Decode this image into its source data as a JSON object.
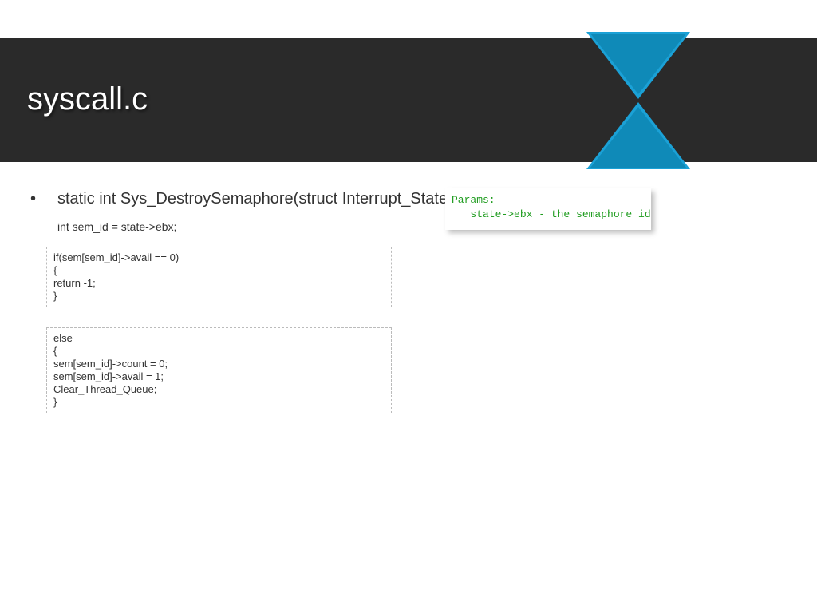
{
  "header": {
    "title": "syscall.c"
  },
  "content": {
    "bullet": "•",
    "func_sig": "static int Sys_DestroySemaphore(struct Interrupt_State* state)",
    "sub_line": "int sem_id = state->ebx;",
    "code1": "if(sem[sem_id]->avail == 0)\n{\nreturn -1;\n}",
    "code2": "else\n{\nsem[sem_id]->count = 0;\nsem[sem_id]->avail = 1;\nClear_Thread_Queue;\n}"
  },
  "params": {
    "text": "Params:\n   state->ebx - the semaphore id"
  },
  "colors": {
    "accent": "#1ba1d6",
    "header_bg": "#2a2a2a",
    "param_text": "#1f9c1f"
  }
}
